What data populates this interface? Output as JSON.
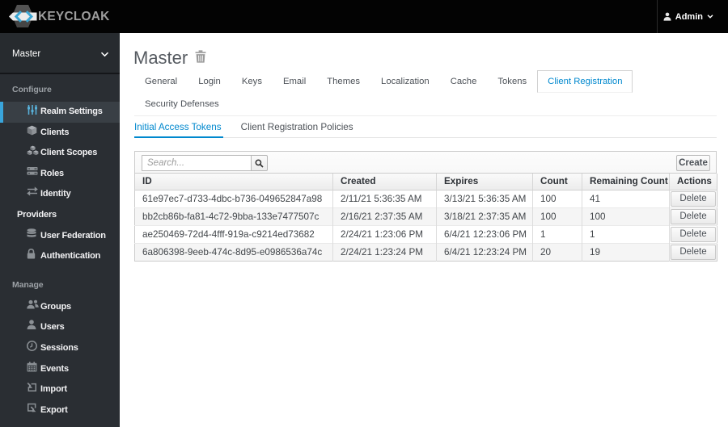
{
  "header": {
    "brand": "KEYCLOAK",
    "user": {
      "name": "Admin"
    },
    "colors": {
      "navbar_bg": "#030303",
      "accent_blue": "#0088ce",
      "sidebar_active_border": "#39a5dc"
    }
  },
  "sidebar": {
    "realm": "Master",
    "sections": [
      {
        "label": "Configure",
        "items": [
          {
            "label": "Realm Settings",
            "icon": "sliders-icon",
            "active": true
          },
          {
            "label": "Clients",
            "icon": "cube-icon",
            "active": false
          },
          {
            "label": "Client Scopes",
            "icon": "cubes-icon",
            "active": false
          },
          {
            "label": "Roles",
            "icon": "roles-icon",
            "active": false
          },
          {
            "label": "Identity Providers",
            "icon": "exchange-icon",
            "active": false
          },
          {
            "label": "User Federation",
            "icon": "database-icon",
            "active": false
          },
          {
            "label": "Authentication",
            "icon": "lock-icon",
            "active": false
          }
        ]
      },
      {
        "label": "Manage",
        "items": [
          {
            "label": "Groups",
            "icon": "users-icon",
            "active": false
          },
          {
            "label": "Users",
            "icon": "user-icon",
            "active": false
          },
          {
            "label": "Sessions",
            "icon": "clock-icon",
            "active": false
          },
          {
            "label": "Events",
            "icon": "calendar-icon",
            "active": false
          },
          {
            "label": "Import",
            "icon": "import-icon",
            "active": false
          },
          {
            "label": "Export",
            "icon": "export-icon",
            "active": false
          }
        ]
      }
    ]
  },
  "main": {
    "title": "Master",
    "tabs": [
      {
        "label": "General",
        "active": false
      },
      {
        "label": "Login",
        "active": false
      },
      {
        "label": "Keys",
        "active": false
      },
      {
        "label": "Email",
        "active": false
      },
      {
        "label": "Themes",
        "active": false
      },
      {
        "label": "Localization",
        "active": false
      },
      {
        "label": "Cache",
        "active": false
      },
      {
        "label": "Tokens",
        "active": false
      },
      {
        "label": "Client Registration",
        "active": true
      },
      {
        "label": "Security Defenses",
        "active": false
      }
    ],
    "subtabs": [
      {
        "label": "Initial Access Tokens",
        "active": true
      },
      {
        "label": "Client Registration Policies",
        "active": false
      }
    ],
    "toolbar": {
      "search_placeholder": "Search...",
      "create_label": "Create"
    },
    "table": {
      "columns": [
        "ID",
        "Created",
        "Expires",
        "Count",
        "Remaining Count",
        "Actions"
      ],
      "action_label": "Delete",
      "rows": [
        {
          "id": "61e97ec7-d733-4dbc-b736-049652847a98",
          "created": "2/11/21 5:36:35 AM",
          "expires": "3/13/21 5:36:35 AM",
          "count": "100",
          "remaining": "41",
          "action": "Delete"
        },
        {
          "id": "bb2cb86b-fa81-4c72-9bba-133e7477507c",
          "created": "2/16/21 2:37:35 AM",
          "expires": "3/18/21 2:37:35 AM",
          "count": "100",
          "remaining": "100",
          "action": "Delete"
        },
        {
          "id": "ae250469-72d4-4fff-919a-c9214ed73682",
          "created": "2/24/21 1:23:06 PM",
          "expires": "6/4/21 12:23:06 PM",
          "count": "1",
          "remaining": "1",
          "action": "Delete"
        },
        {
          "id": "6a806398-9eeb-474c-8d95-e0986536a74c",
          "created": "2/24/21 1:23:24 PM",
          "expires": "6/4/21 12:23:24 PM",
          "count": "20",
          "remaining": "19",
          "action": "Delete"
        }
      ]
    }
  }
}
